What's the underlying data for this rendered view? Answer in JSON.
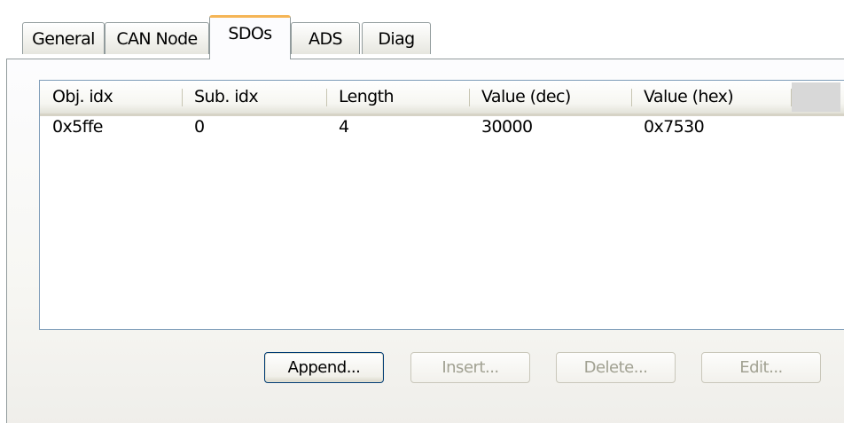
{
  "tabs": {
    "general": "General",
    "can_node": "CAN Node",
    "sdos": "SDOs",
    "ads": "ADS",
    "diag": "Diag",
    "active": "SDOs"
  },
  "list": {
    "columns": [
      "Obj. idx",
      "Sub. idx",
      "Length",
      "Value (dec)",
      "Value (hex)"
    ],
    "rows": [
      [
        "0x5ffe",
        "0",
        "4",
        "30000",
        "0x7530"
      ]
    ]
  },
  "buttons": {
    "append": "Append...",
    "insert": "Insert...",
    "delete": "Delete...",
    "edit": "Edit..."
  },
  "button_states": {
    "append": "enabled",
    "insert": "disabled",
    "delete": "disabled",
    "edit": "disabled"
  },
  "colors": {
    "active_tab_accent": "#f5b556",
    "list_border": "#7f9db9",
    "default_button_border": "#003c74",
    "disabled_text": "#a1a192"
  }
}
